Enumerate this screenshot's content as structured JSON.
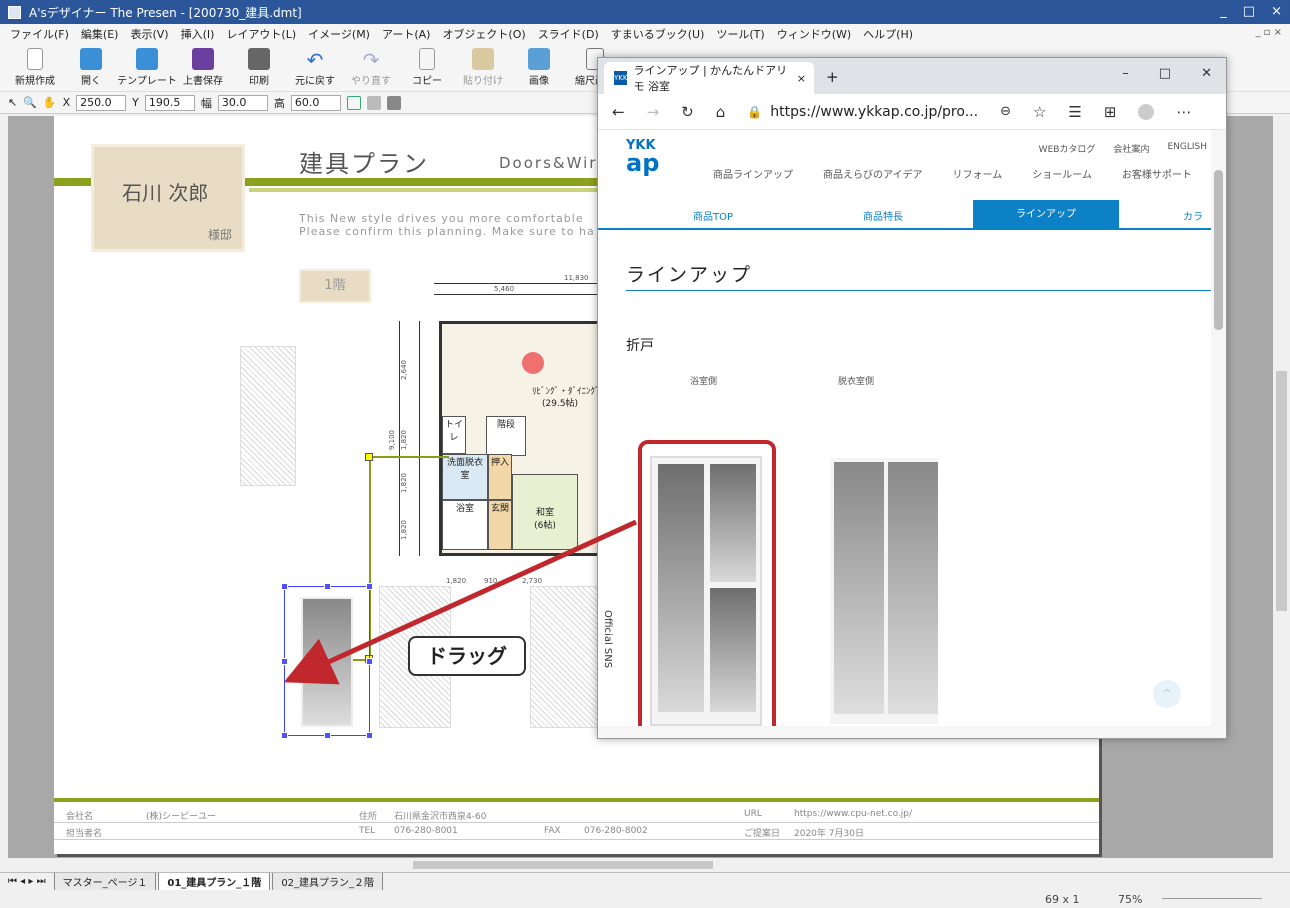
{
  "titlebar": {
    "title": "A'sデザイナー The Presen - [200730_建具.dmt]",
    "min": "_",
    "max": "□",
    "close": "×"
  },
  "menu": [
    "ファイル(F)",
    "編集(E)",
    "表示(V)",
    "挿入(I)",
    "レイアウト(L)",
    "イメージ(M)",
    "アート(A)",
    "オブジェクト(O)",
    "スライド(D)",
    "すまいるブック(U)",
    "ツール(T)",
    "ウィンドウ(W)",
    "ヘルプ(H)"
  ],
  "toolbar": [
    "新規作成",
    "開く",
    "テンプレート",
    "上書保存",
    "印刷",
    "元に戻す",
    "やり直す",
    "コピー",
    "貼り付け",
    "画像",
    "縮尺画像"
  ],
  "props": {
    "x_label": "X",
    "x": "250.0",
    "y_label": "Y",
    "y": "190.5",
    "w_label": "幅",
    "w": "30.0",
    "h_label": "高",
    "h": "60.0"
  },
  "page": {
    "client_name": "石川 次郎",
    "suffix": "様邸",
    "title_jp": "建具プラン",
    "title_en": "Doors&Wir",
    "desc1": "This New style drives you more comfortable",
    "desc2": "Please confirm this planning. Make sure to ha",
    "floor": "1階",
    "rooms": [
      "ﾘﾋﾞﾝｸﾞ・ﾀﾞｲﾆﾝｸﾞ",
      "(29.5帖)",
      "トイレ",
      "階段",
      "洗面脱衣室",
      "押入",
      "浴室",
      "玄関",
      "和室",
      "(6帖)"
    ],
    "dims": [
      "11,830",
      "5,460",
      "2,640",
      "9,100",
      "1,820",
      "1,820",
      "1,820",
      "1,820",
      "910",
      "2,730"
    ]
  },
  "footer": {
    "company_label": "会社名",
    "company": "(株)シーピーユー",
    "address_label": "住所",
    "address": "石川県金沢市西泉4-60",
    "url_label": "URL",
    "url": "https://www.cpu-net.co.jp/",
    "person_label": "担当者名",
    "tel_label": "TEL",
    "tel": "076-280-8001",
    "fax_label": "FAX",
    "fax": "076-280-8002",
    "date_label": "ご提案日",
    "date": "2020年 7月30日"
  },
  "tabs": [
    "マスター_ページ１",
    "01_建具プラン_１階",
    "02_建具プラン_２階"
  ],
  "status": {
    "coords": "69 x   1",
    "zoom": "75%"
  },
  "browser": {
    "tab_title": "ラインアップ | かんたんドアリモ 浴室",
    "url": "https://www.ykkap.co.jp/pro...",
    "logo_top": "YKK",
    "logo_bottom": "ap",
    "toplinks": [
      "WEBカタログ",
      "会社案内",
      "ENGLISH"
    ],
    "nav": [
      "商品ラインアップ",
      "商品えらびのアイデア",
      "リフォーム",
      "ショールーム",
      "お客様サポート"
    ],
    "subnav": [
      "商品TOP",
      "商品特長",
      "ラインアップ",
      "カラ"
    ],
    "heading": "ラインアップ",
    "section": "折戸",
    "caption_left": "浴室側",
    "caption_right": "脱衣室側",
    "sns": "Official SNS",
    "up": "^"
  },
  "drag_label": "ドラッグ"
}
